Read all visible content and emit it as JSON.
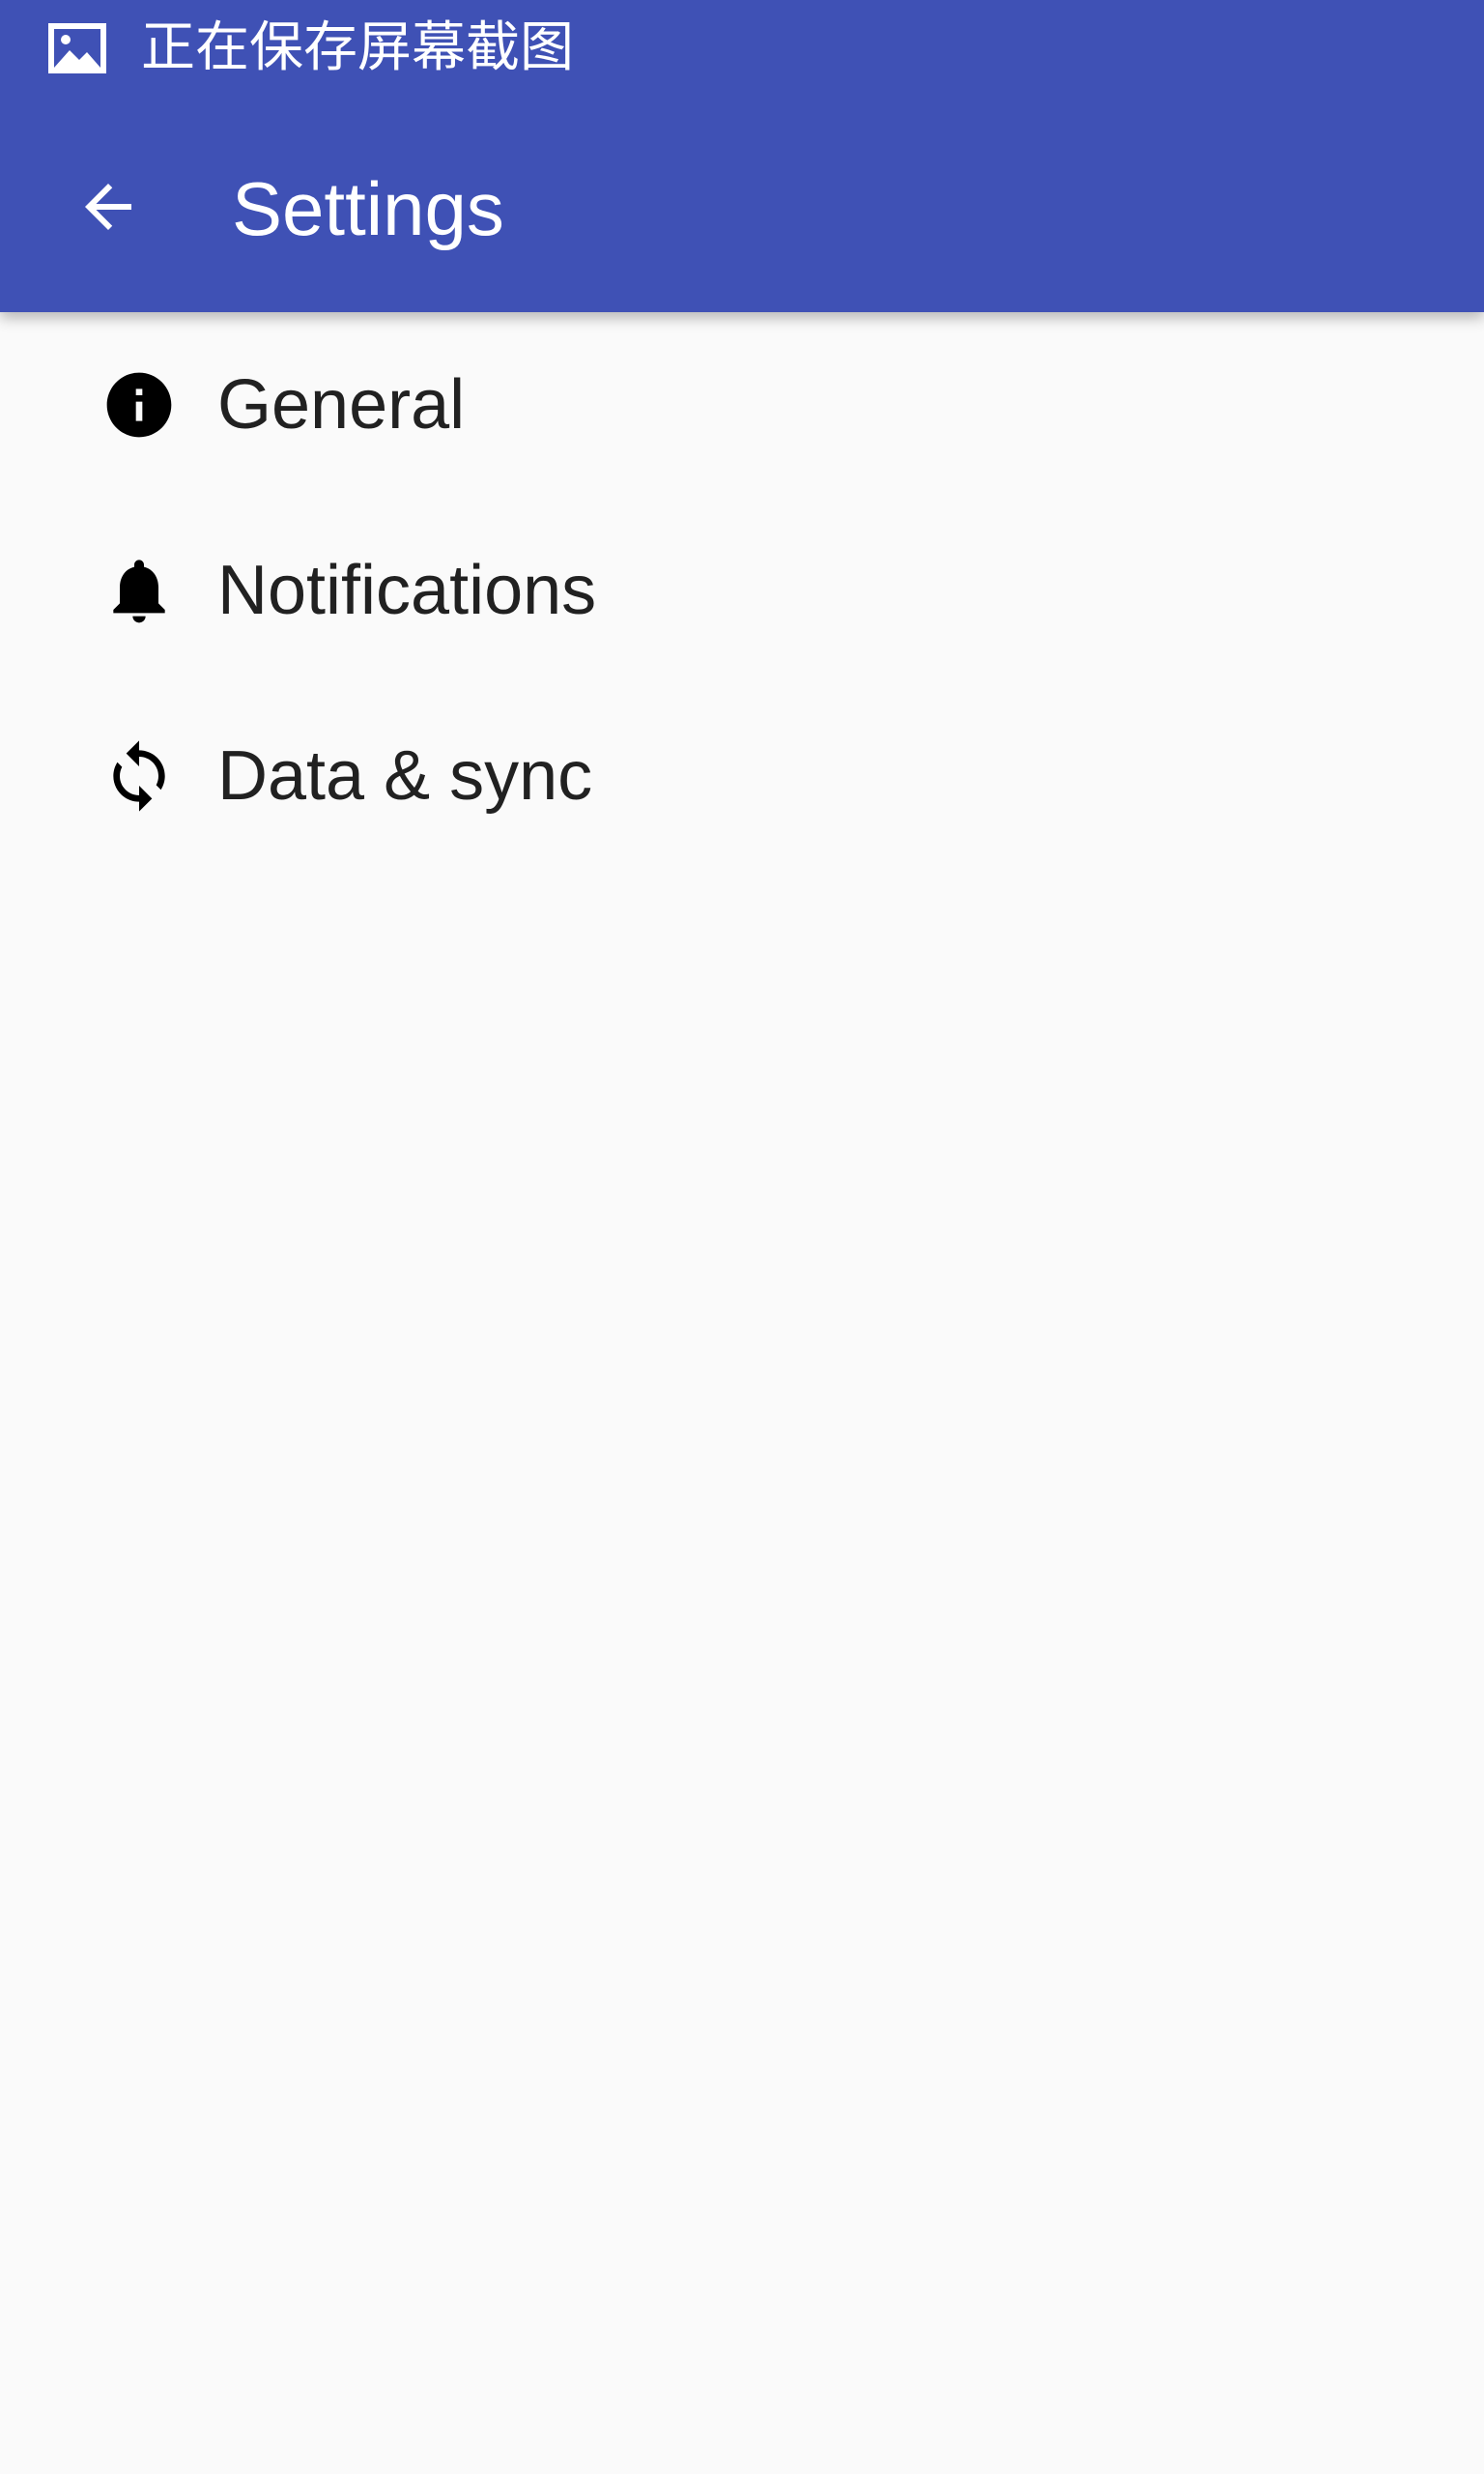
{
  "status_bar": {
    "icon": "image-icon",
    "text": "正在保存屏幕截图"
  },
  "toolbar": {
    "back_icon": "arrow-left-icon",
    "title": "Settings"
  },
  "settings_list": {
    "items": [
      {
        "icon": "info-icon",
        "label": "General"
      },
      {
        "icon": "bell-icon",
        "label": "Notifications"
      },
      {
        "icon": "sync-icon",
        "label": "Data & sync"
      }
    ]
  },
  "colors": {
    "primary": "#3f51b5",
    "background": "#fafafa",
    "text_primary": "#212121",
    "on_primary": "#ffffff",
    "icon": "#000000"
  }
}
